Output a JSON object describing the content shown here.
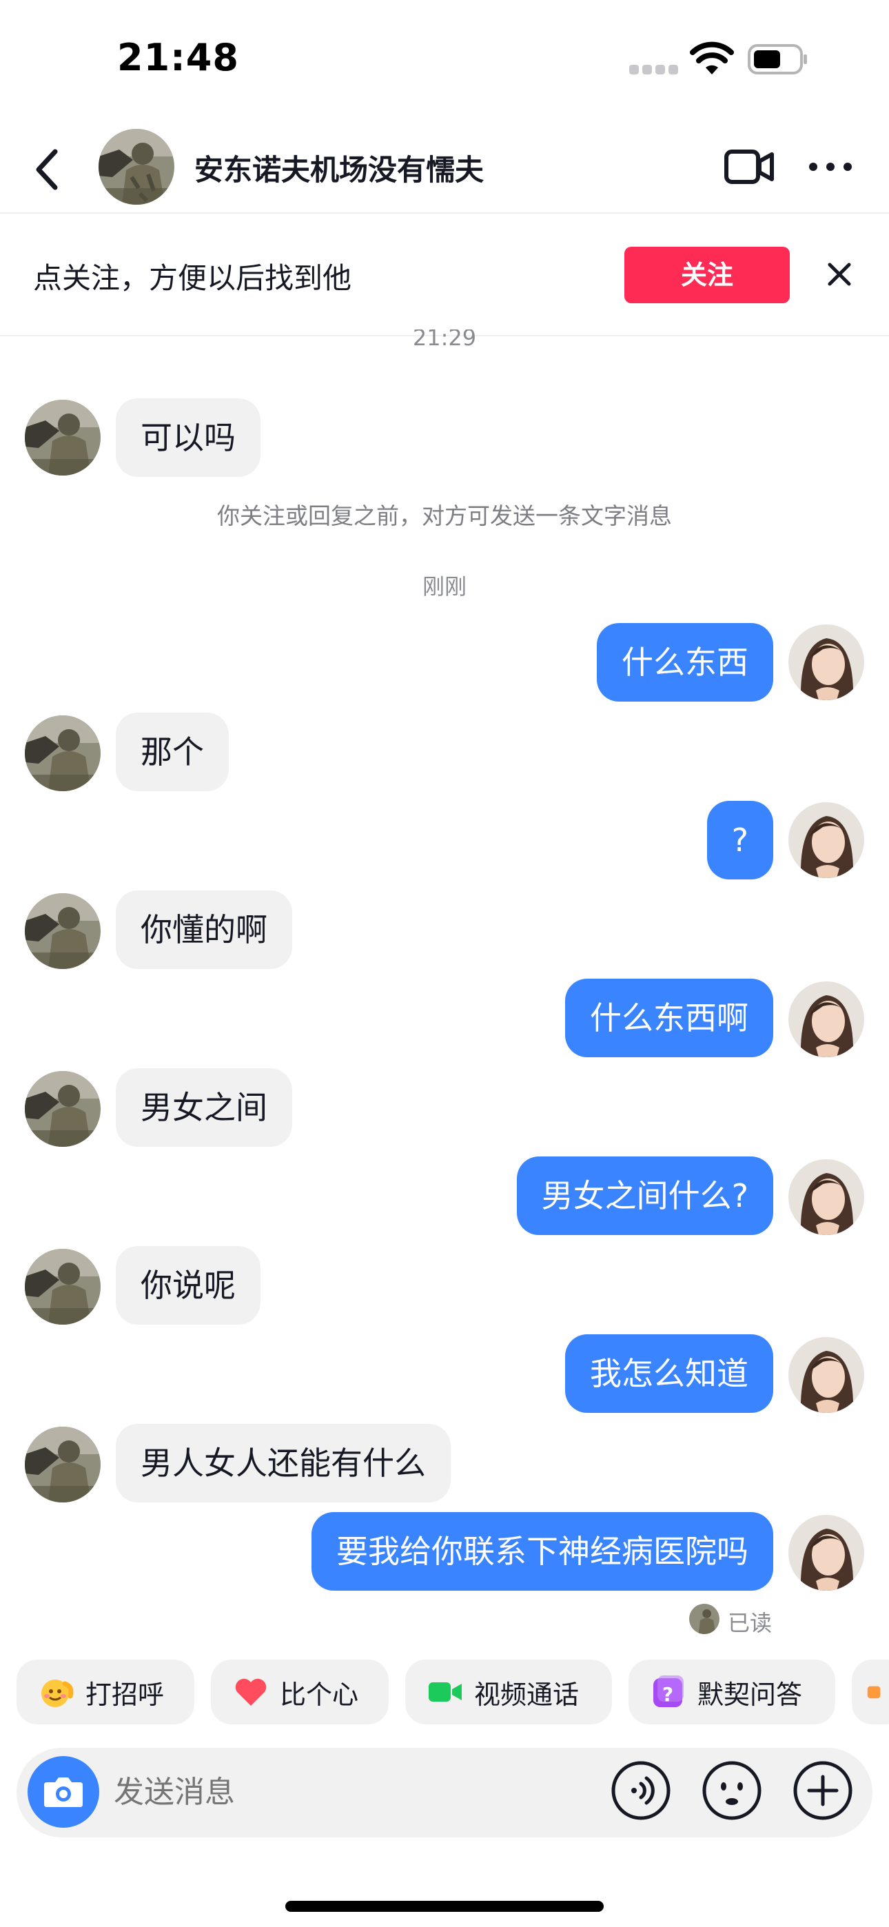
{
  "status_bar": {
    "time": "21:48"
  },
  "header": {
    "title": "安东诺夫机场没有懦夫",
    "back_icon": "chevron-left-icon",
    "video_icon": "video-camera-icon",
    "more_icon": "more-dots-icon"
  },
  "follow_banner": {
    "text": "点关注，方便以后找到他",
    "button_label": "关注",
    "button_color": "#fe2c55",
    "close_icon": "close-icon"
  },
  "chat": {
    "partial_time": "21:29",
    "notice": "你关注或回复之前，对方可发送一条文字消息",
    "time_label": "刚刚",
    "messages": [
      {
        "from": "them",
        "text": "可以吗"
      },
      {
        "from": "me",
        "text": "什么东西"
      },
      {
        "from": "them",
        "text": "那个"
      },
      {
        "from": "me",
        "text": "?"
      },
      {
        "from": "them",
        "text": "你懂的啊"
      },
      {
        "from": "me",
        "text": "什么东西啊"
      },
      {
        "from": "them",
        "text": "男女之间"
      },
      {
        "from": "me",
        "text": "男女之间什么?"
      },
      {
        "from": "them",
        "text": "你说呢"
      },
      {
        "from": "me",
        "text": "我怎么知道"
      },
      {
        "from": "them",
        "text": "男人女人还能有什么"
      },
      {
        "from": "me",
        "text": "要我给你联系下神经病医院吗"
      }
    ],
    "read_status": "已读",
    "outgoing_color": "#3a85ff",
    "incoming_color": "#f1f1f2"
  },
  "quick_replies": [
    {
      "label": "打招呼",
      "icon": "wave-emoji-icon"
    },
    {
      "label": "比个心",
      "icon": "heart-icon"
    },
    {
      "label": "视频通话",
      "icon": "video-call-icon"
    },
    {
      "label": "默契问答",
      "icon": "question-icon"
    }
  ],
  "input": {
    "placeholder": "发送消息",
    "camera_icon": "camera-icon",
    "voice_icon": "voice-icon",
    "emoji_icon": "emoji-icon",
    "plus_icon": "plus-icon"
  }
}
